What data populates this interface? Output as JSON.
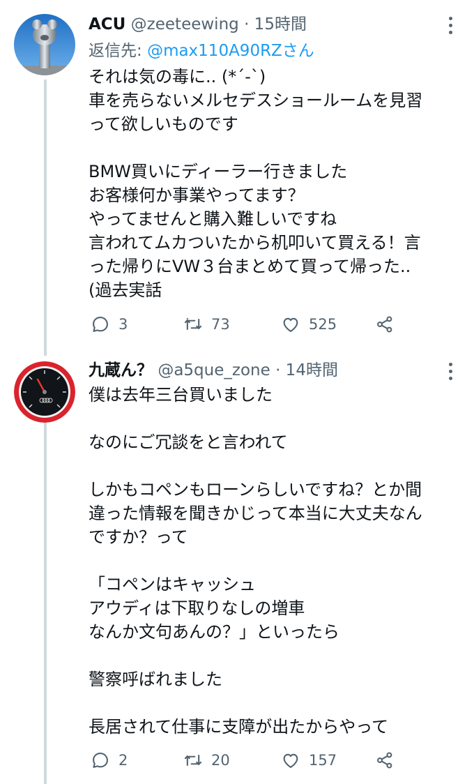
{
  "tweets": [
    {
      "name": "ACU",
      "handle": "@zeeteewing",
      "time": "· 15時間",
      "reply_prefix": "返信先: ",
      "reply_to": "@max110A90RZさん",
      "lines": [
        "それは気の毒に.. (*´-`)",
        "車を売らないメルセデスショールームを見習",
        "って欲しいものです",
        "",
        "BMW買いにディーラー行きました",
        "お客様何か事業やってます？",
        "やってませんと購入難しいですね",
        "言われてムカついたから机叩いて買える！言",
        "った帰りにVW３台まとめて買って帰った..",
        "(過去実話"
      ],
      "stats": {
        "replies": "3",
        "retweets": "73",
        "likes": "525"
      }
    },
    {
      "name": "九蔵ん？",
      "handle": "@a5que_zone",
      "time": "· 14時間",
      "lines": [
        "僕は去年三台買いました",
        "",
        "なのにご冗談をと言われて",
        "",
        "しかもコペンもローンらしいですね？とか間",
        "違った情報を聞きかじって本当に大丈夫なん",
        "ですか？って",
        "",
        "「コペンはキャッシュ",
        "アウディは下取りなしの増車",
        "なんか文句あんの？」といったら",
        "",
        "警察呼ばれました",
        "",
        "長居されて仕事に支障が出たからやって"
      ],
      "stats": {
        "replies": "2",
        "retweets": "20",
        "likes": "157"
      }
    }
  ],
  "icons": {
    "reply": "reply-icon",
    "retweet": "retweet-icon",
    "like": "heart-icon",
    "share": "share-icon",
    "more": "more-options-icon"
  },
  "colors": {
    "link": "#1d9bf0",
    "secondary_text": "#536471",
    "thread_line": "#cfd9de",
    "gauge_rim": "#d9232d"
  }
}
